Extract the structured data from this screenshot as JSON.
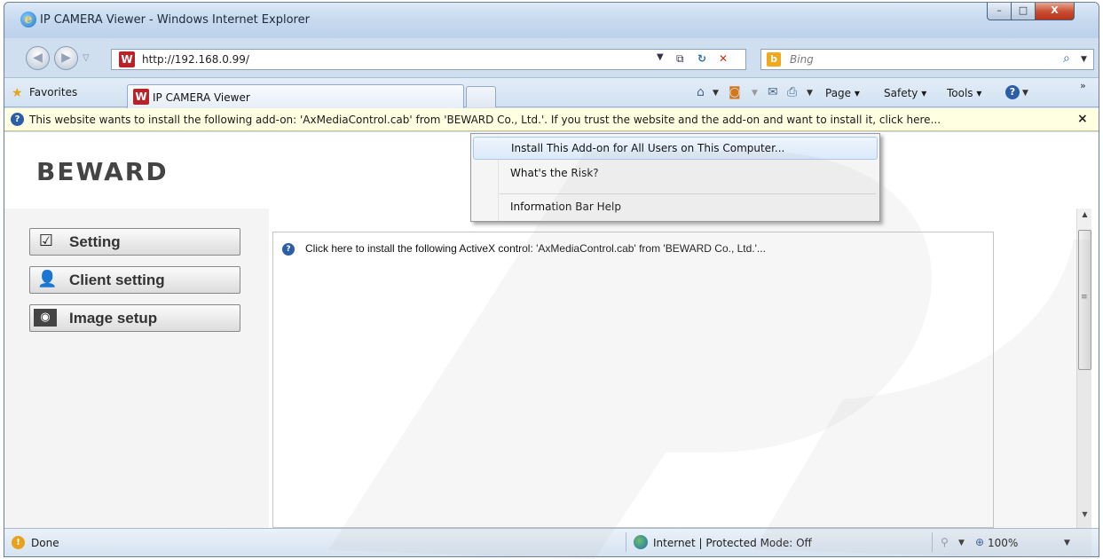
{
  "window": {
    "title": "IP CAMERA Viewer - Windows Internet Explorer",
    "buttons": {
      "minimize": "–",
      "maximize": "□",
      "close": "X"
    }
  },
  "address_bar": {
    "url": "http://192.168.0.99/",
    "search_placeholder": "Bing",
    "icons": [
      "back-icon",
      "forward-icon",
      "compatibility-view-icon",
      "refresh-icon",
      "stop-icon",
      "search-icon"
    ]
  },
  "favorites_bar": {
    "favorites_label": "Favorites",
    "tab_title": "IP CAMERA Viewer",
    "commands": {
      "page": "Page ▾",
      "safety": "Safety ▾",
      "tools": "Tools ▾"
    }
  },
  "info_bar": {
    "message": "This website wants to install the following add-on: 'AxMediaControl.cab' from 'BEWARD Co., Ltd.'. If you trust the website and the add-on and want to install it, click here...",
    "close": "×"
  },
  "context_menu": {
    "items": [
      {
        "label": "Install This Add-on for All Users on This Computer..."
      },
      {
        "label": "What's the Risk?"
      },
      {
        "label": "Information Bar Help"
      }
    ]
  },
  "page": {
    "logo_text": "BEWARD",
    "sidebar": [
      {
        "label": "Setting",
        "icon": "checkbox-icon"
      },
      {
        "label": "Client setting",
        "icon": "user-icon"
      },
      {
        "label": "Image setup",
        "icon": "camera-icon"
      }
    ],
    "activex_prompt": "Click here to install the following ActiveX control: 'AxMediaControl.cab' from 'BEWARD Co., Ltd.'..."
  },
  "status_bar": {
    "status": "Done",
    "zone": "Internet | Protected Mode: Off",
    "zoom": "100%"
  },
  "colors": {
    "info_bar_bg": "#ffffe1",
    "close_button": "#c94b30",
    "brand": "#b8232a"
  }
}
